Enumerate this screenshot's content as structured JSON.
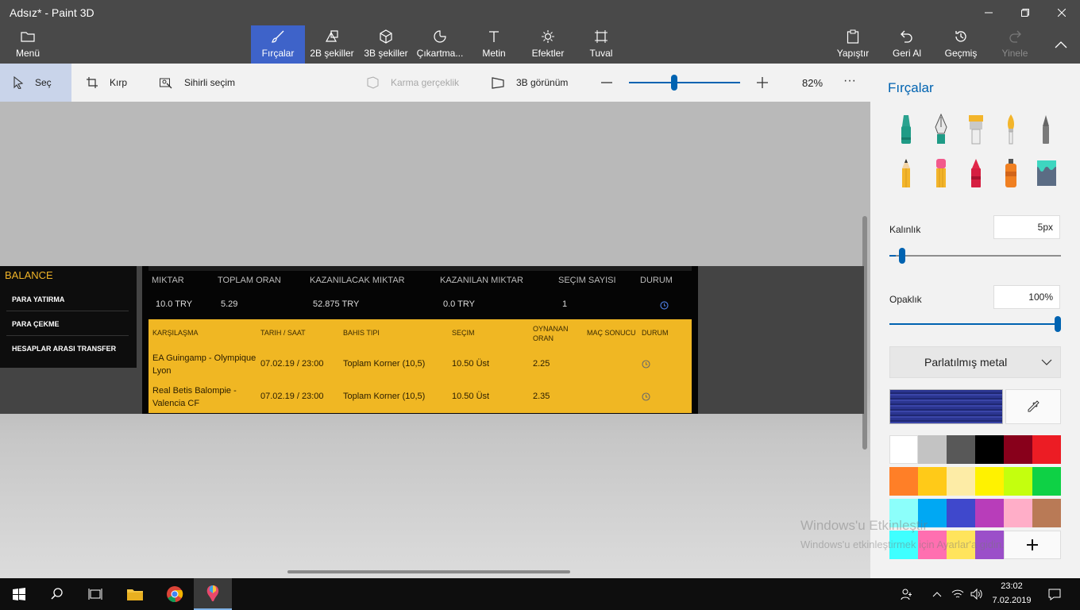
{
  "window": {
    "title": "Adsız* - Paint 3D"
  },
  "ribbon": {
    "menu": "Menü",
    "tools": [
      {
        "label": "Fırçalar",
        "icon": "brush-icon",
        "selected": true
      },
      {
        "label": "2B şekiller",
        "icon": "shapes-2d-icon"
      },
      {
        "label": "3B şekiller",
        "icon": "cube-icon"
      },
      {
        "label": "Çıkartma...",
        "icon": "sticker-icon"
      },
      {
        "label": "Metin",
        "icon": "text-icon"
      },
      {
        "label": "Efektler",
        "icon": "effects-icon"
      },
      {
        "label": "Tuval",
        "icon": "canvas-icon"
      }
    ],
    "paste": "Yapıştır",
    "undo": "Geri Al",
    "history": "Geçmiş",
    "redo": "Yinele"
  },
  "toolbar": {
    "select": "Seç",
    "crop": "Kırp",
    "magic_select": "Sihirli seçim",
    "mixed_reality": "Karma gerçeklik",
    "view3d": "3B görünüm",
    "zoom": "82%"
  },
  "image": {
    "sidebar_title": "BALANCE",
    "sidebar_items": [
      "PARA YATIRMA",
      "PARA ÇEKME",
      "HESAPLAR ARASI TRANSFER"
    ],
    "summary_headers": [
      "MIKTAR",
      "TOPLAM ORAN",
      "KAZANILACAK MIKTAR",
      "KAZANILAN MIKTAR",
      "SEÇIM SAYISI",
      "DURUM"
    ],
    "summary_values": [
      "10.0 TRY",
      "5.29",
      "52.875 TRY",
      "0.0 TRY",
      "1"
    ],
    "bet_headers": [
      "KARŞILAŞMA",
      "TARIH / SAAT",
      "BAHIS TIPI",
      "SEÇIM",
      "OYNANAN ORAN",
      "MAÇ SONUCU",
      "DURUM"
    ],
    "bets": [
      {
        "match": "EA Guingamp - Olympique Lyon",
        "date": "07.02.19 / 23:00",
        "type": "Toplam Korner (10,5)",
        "pick": "10.50 Üst",
        "odds": "2.25"
      },
      {
        "match": "Real Betis Balompie - Valencia CF",
        "date": "07.02.19 / 23:00",
        "type": "Toplam Korner (10,5)",
        "pick": "10.50 Üst",
        "odds": "2.35"
      }
    ]
  },
  "panel": {
    "title": "Fırçalar",
    "thickness_label": "Kalınlık",
    "thickness_value": "5px",
    "thickness_level": 0.02,
    "opacity_label": "Opaklık",
    "opacity_value": "100%",
    "opacity_level": 1.0,
    "material": "Parlatılmış metal",
    "current_color": "#2b3590",
    "palette": [
      "#ffffff",
      "#c3c3c3",
      "#585858",
      "#000000",
      "#88001b",
      "#ec1c24",
      "#ff7f27",
      "#ffca18",
      "#fdeca6",
      "#fff200",
      "#c4ff0e",
      "#0ed145",
      "#8cfffb",
      "#00a8f3",
      "#3f48cc",
      "#b83dba",
      "#ffaec8",
      "#b97a56",
      "#3fffff",
      "#ff6fb0",
      "#ffe45c",
      "#9b4fc9"
    ]
  },
  "watermark": {
    "line1": "Windows'u Etkinleştir",
    "line2": "Windows'u etkinleştirmek için Ayarlar'a gidin."
  },
  "taskbar": {
    "time": "23:02",
    "date": "7.02.2019"
  }
}
